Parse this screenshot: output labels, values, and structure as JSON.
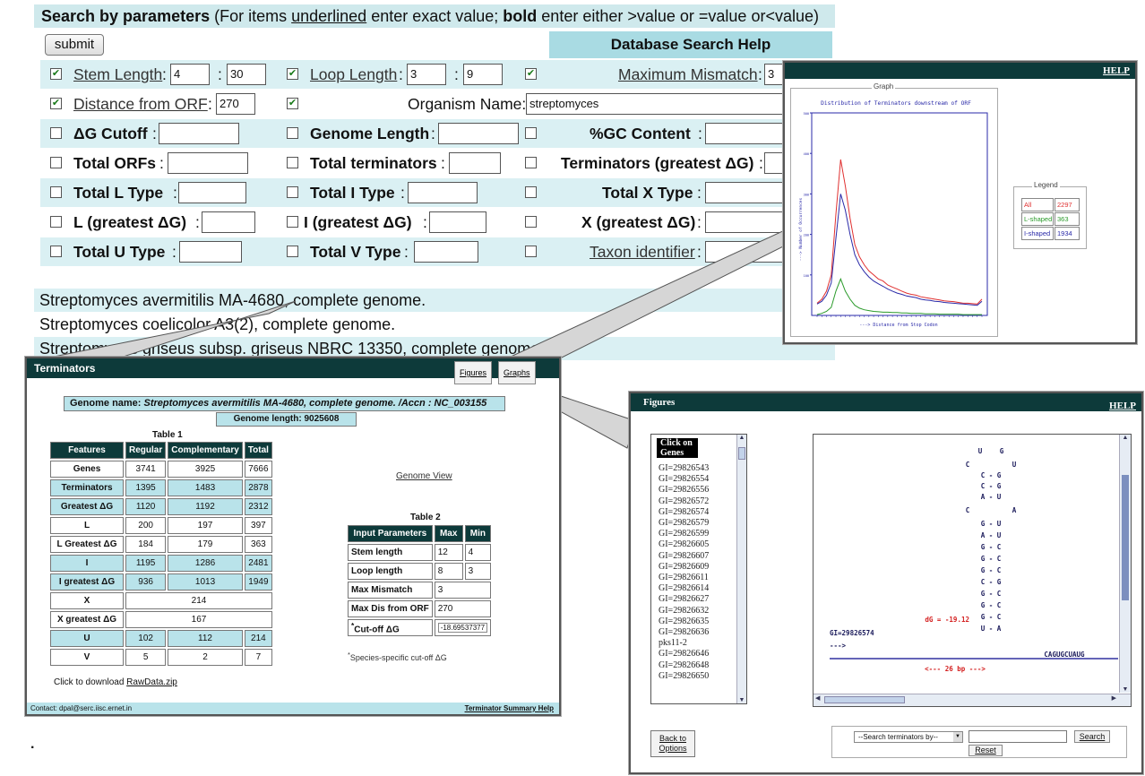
{
  "search": {
    "header_title": "Search by parameters",
    "header_pre": " (For items ",
    "header_underlined": "underlined",
    "header_mid": " enter exact value; ",
    "header_bold": "bold",
    "header_post": " enter either >value or =value or<value)",
    "submit": "submit",
    "help": "Database Search Help",
    "colon": ":",
    "fields": {
      "stem_length": {
        "label": "Stem Length",
        "min": "4",
        "max": "30"
      },
      "loop_length": {
        "label": "Loop Length",
        "min": "3",
        "max": "9"
      },
      "max_mismatch": {
        "label": "Maximum Mismatch",
        "value": "3"
      },
      "distance_orf": {
        "label": "Distance from ORF",
        "value": "270"
      },
      "organism": {
        "label": "Organism Name:",
        "value": "streptomyces"
      },
      "dg_cutoff": "ΔG Cutoff",
      "genome_length": "Genome Length",
      "gc_content": "%GC Content",
      "total_orfs": "Total ORFs",
      "total_terminators": "Total terminators",
      "terminators_greatest": "Terminators (greatest ΔG)",
      "total_l": "Total L Type",
      "total_i": "Total I Type",
      "total_x": "Total X Type",
      "l_greatest": "L (greatest ΔG)",
      "i_greatest": "I (greatest ΔG)",
      "x_greatest": "X (greatest ΔG)",
      "total_u": "Total U Type",
      "total_v": "Total V Type",
      "taxon": "Taxon identifier"
    },
    "results": [
      "Streptomyces avermitilis MA-4680, complete genome.",
      "Streptomyces coelicolor A3(2), complete genome.",
      "Streptomyces griseus subsp. griseus NBRC 13350, complete genome."
    ]
  },
  "graph_window": {
    "help": "HELP",
    "group_label": "Graph",
    "chart_title": "Distribution of Terminators downstream of ORF",
    "xlabel": "---> Distance from Stop Codon",
    "ylabel": "---> Number of Occurrences",
    "legend_title": "Legend",
    "legend": [
      {
        "name": "All",
        "count": "2297",
        "color": "#e03030"
      },
      {
        "name": "L-shaped",
        "count": "363",
        "color": "#2a9a2a"
      },
      {
        "name": "I-shaped",
        "count": "1934",
        "color": "#2a2aa8"
      }
    ]
  },
  "chart_data": {
    "type": "line",
    "title": "Distribution of Terminators downstream of ORF",
    "xlabel": "---> Distance from Stop Codon",
    "ylabel": "---> Number of Occurrences",
    "ylim": [
      0,
      500
    ],
    "yticks": [
      "100",
      "200",
      "300",
      "400",
      "500"
    ],
    "series": [
      {
        "name": "All",
        "color": "#e03030",
        "values": [
          30,
          40,
          60,
          100,
          250,
          385,
          320,
          240,
          175,
          145,
          125,
          110,
          100,
          90,
          85,
          75,
          70,
          65,
          60,
          55,
          52,
          50,
          46,
          44,
          42,
          40,
          38,
          36,
          35,
          34,
          32,
          30,
          30,
          29,
          28,
          40
        ]
      },
      {
        "name": "I-shaped",
        "color": "#2a2aa8",
        "values": [
          28,
          35,
          50,
          80,
          190,
          300,
          260,
          200,
          150,
          125,
          108,
          95,
          85,
          78,
          72,
          65,
          60,
          55,
          52,
          48,
          46,
          44,
          40,
          38,
          37,
          35,
          34,
          32,
          31,
          30,
          29,
          28,
          27,
          26,
          25,
          35
        ]
      },
      {
        "name": "L-shaped",
        "color": "#2a9a2a",
        "values": [
          2,
          5,
          10,
          20,
          60,
          90,
          60,
          40,
          25,
          18,
          14,
          12,
          10,
          9,
          8,
          8,
          7,
          7,
          6,
          6,
          5,
          5,
          5,
          4,
          4,
          4,
          3,
          3,
          3,
          3,
          3,
          2,
          2,
          2,
          2,
          2
        ]
      }
    ]
  },
  "terminators": {
    "title": "Terminators",
    "figures_btn": "Figures",
    "graphs_btn": "Graphs",
    "genome_name_prefix": "Genome name: ",
    "genome_name": "Streptomyces avermitilis MA-4680, complete genome. /Accn : NC_003155",
    "genome_length": "Genome length: 9025608",
    "table1_caption": "Table 1",
    "table1_headers": [
      "Features",
      "Regular",
      "Complementary",
      "Total"
    ],
    "table1_rows": [
      [
        "Genes",
        "3741",
        "3925",
        "7666"
      ],
      [
        "Terminators",
        "1395",
        "1483",
        "2878"
      ],
      [
        "Greatest ΔG",
        "1120",
        "1192",
        "2312"
      ],
      [
        "L",
        "200",
        "197",
        "397"
      ],
      [
        "L Greatest ΔG",
        "184",
        "179",
        "363"
      ],
      [
        "I",
        "1195",
        "1286",
        "2481"
      ],
      [
        "I greatest ΔG",
        "936",
        "1013",
        "1949"
      ],
      [
        "X",
        "214"
      ],
      [
        "X greatest ΔG",
        "167"
      ],
      [
        "U",
        "102",
        "112",
        "214"
      ],
      [
        "V",
        "5",
        "2",
        "7"
      ]
    ],
    "genome_view": "Genome View",
    "table2_caption": "Table 2",
    "table2_headers": [
      "Input Parameters",
      "Max",
      "Min"
    ],
    "table2_rows": [
      [
        "Stem length",
        "12",
        "4"
      ],
      [
        "Loop length",
        "8",
        "3"
      ],
      [
        "Max Mismatch",
        "3"
      ],
      [
        "Max Dis from ORF",
        "270"
      ],
      [
        "Cut-off ΔG",
        "-18.69537377"
      ]
    ],
    "footnote": "Species-specific cut-off ΔG",
    "download_text": "Click to download ",
    "download_link": "RawData.zip",
    "contact": "Contact: dpal@serc.iisc.ernet.in",
    "summary_help": "Terminator Summary Help"
  },
  "figures": {
    "title": "Figures",
    "help": "HELP",
    "list_header": "Click on Genes",
    "genes": [
      "GI=29826543",
      "GI=29826554",
      "GI=29826556",
      "GI=29826572",
      "GI=29826574",
      "GI=29826579",
      "GI=29826599",
      "GI=29826605",
      "GI=29826607",
      "GI=29826609",
      "GI=29826611",
      "GI=29826614",
      "GI=29826627",
      "GI=29826632",
      "GI=29826635",
      "GI=29826636",
      "pks11-2",
      "GI=29826646",
      "GI=29826648",
      "GI=29826650"
    ],
    "structure_gi": "GI=29826574",
    "arrow": "--->",
    "dg_label": "dG = -19.12",
    "tail": "CAGUGCUAUG",
    "bp_label": "<--- 26 bp --->",
    "back_btn": "Back to Options",
    "search_select": "--Search terminators by--",
    "search_btn": "Search",
    "reset_btn": "Reset"
  },
  "dot": "."
}
